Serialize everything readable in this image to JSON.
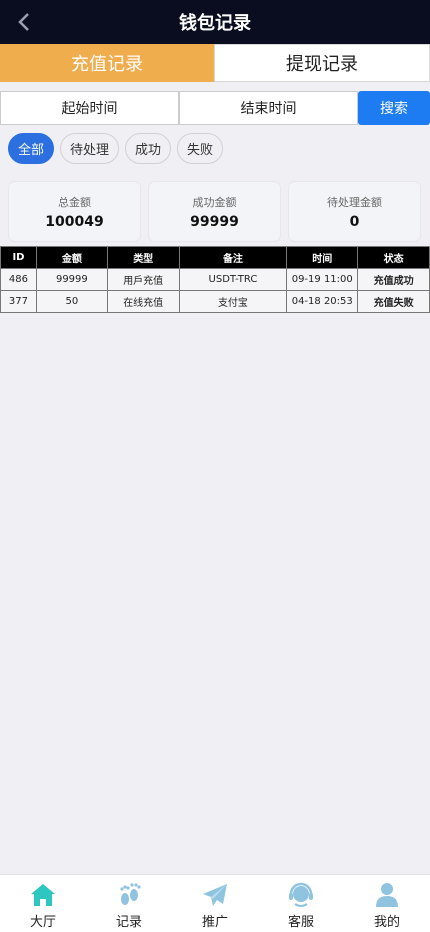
{
  "header": {
    "title": "钱包记录"
  },
  "tabs": [
    {
      "label": "充值记录",
      "active": true
    },
    {
      "label": "提现记录",
      "active": false
    }
  ],
  "filters": {
    "start_label": "起始时间",
    "end_label": "结束时间",
    "search_label": "搜索"
  },
  "status_filters": [
    {
      "label": "全部",
      "active": true
    },
    {
      "label": "待处理",
      "active": false
    },
    {
      "label": "成功",
      "active": false
    },
    {
      "label": "失败",
      "active": false
    }
  ],
  "stats": [
    {
      "label": "总金额",
      "value": "100049"
    },
    {
      "label": "成功金额",
      "value": "99999"
    },
    {
      "label": "待处理金额",
      "value": "0"
    }
  ],
  "table": {
    "columns": [
      "ID",
      "金额",
      "类型",
      "备注",
      "时间",
      "状态"
    ],
    "rows": [
      {
        "id": "486",
        "amount": "99999",
        "type": "用戶充值",
        "note": "USDT-TRC",
        "time": "09-19 11:00",
        "status": "充值成功",
        "status_color": "#1a9e3a"
      },
      {
        "id": "377",
        "amount": "50",
        "type": "在线充值",
        "note": "支付宝",
        "time": "04-18 20:53",
        "status": "充值失败",
        "status_color": "#e0262a"
      }
    ]
  },
  "bottom_nav": [
    {
      "label": "大厅",
      "icon": "home-icon",
      "color": "#2dc7c0"
    },
    {
      "label": "记录",
      "icon": "footprint-icon",
      "color": "#8fc3e0"
    },
    {
      "label": "推广",
      "icon": "paper-plane-icon",
      "color": "#8fc3e0"
    },
    {
      "label": "客服",
      "icon": "headset-icon",
      "color": "#8fc3e0"
    },
    {
      "label": "我的",
      "icon": "user-icon",
      "color": "#8fc3e0"
    }
  ],
  "colors": {
    "header_bg": "#0a0d1f",
    "tab_active": "#f0ad4e",
    "search_btn": "#1e7cf2",
    "pill_active": "#2b6fe0"
  }
}
